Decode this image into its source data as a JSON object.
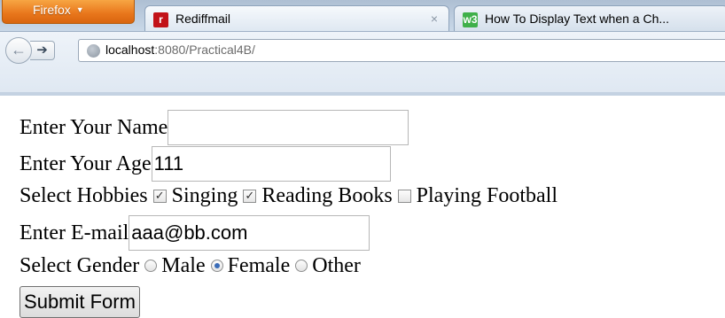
{
  "browser": {
    "menu_button": "Firefox",
    "tabs": [
      {
        "label": "Rediffmail",
        "icon": "rediff-icon"
      },
      {
        "label": "How To Display Text when a Ch...",
        "icon": "w3-icon",
        "icon_text": "w3"
      }
    ],
    "close_glyph": "×",
    "url_host": "localhost",
    "url_path": ":8080/Practical4B/"
  },
  "form": {
    "name_label": "Enter Your Name",
    "name_value": "",
    "age_label": "Enter Your Age",
    "age_value": "111",
    "hobbies_label": "Select Hobbies",
    "hobbies": [
      {
        "label": "Singing",
        "checked": true
      },
      {
        "label": "Reading Books",
        "checked": true
      },
      {
        "label": "Playing Football",
        "checked": false
      }
    ],
    "email_label": "Enter E-mail",
    "email_value": "aaa@bb.com",
    "gender_label": "Select Gender",
    "genders": [
      {
        "label": "Male",
        "selected": false
      },
      {
        "label": "Female",
        "selected": true
      },
      {
        "label": "Other",
        "selected": false
      }
    ],
    "submit_label": "Submit Form"
  },
  "colors": {
    "firefox_orange": "#e8761b",
    "radio_dot": "#3a6cb8",
    "rediff_red": "#c21218",
    "w3_green": "#3fb04a"
  }
}
